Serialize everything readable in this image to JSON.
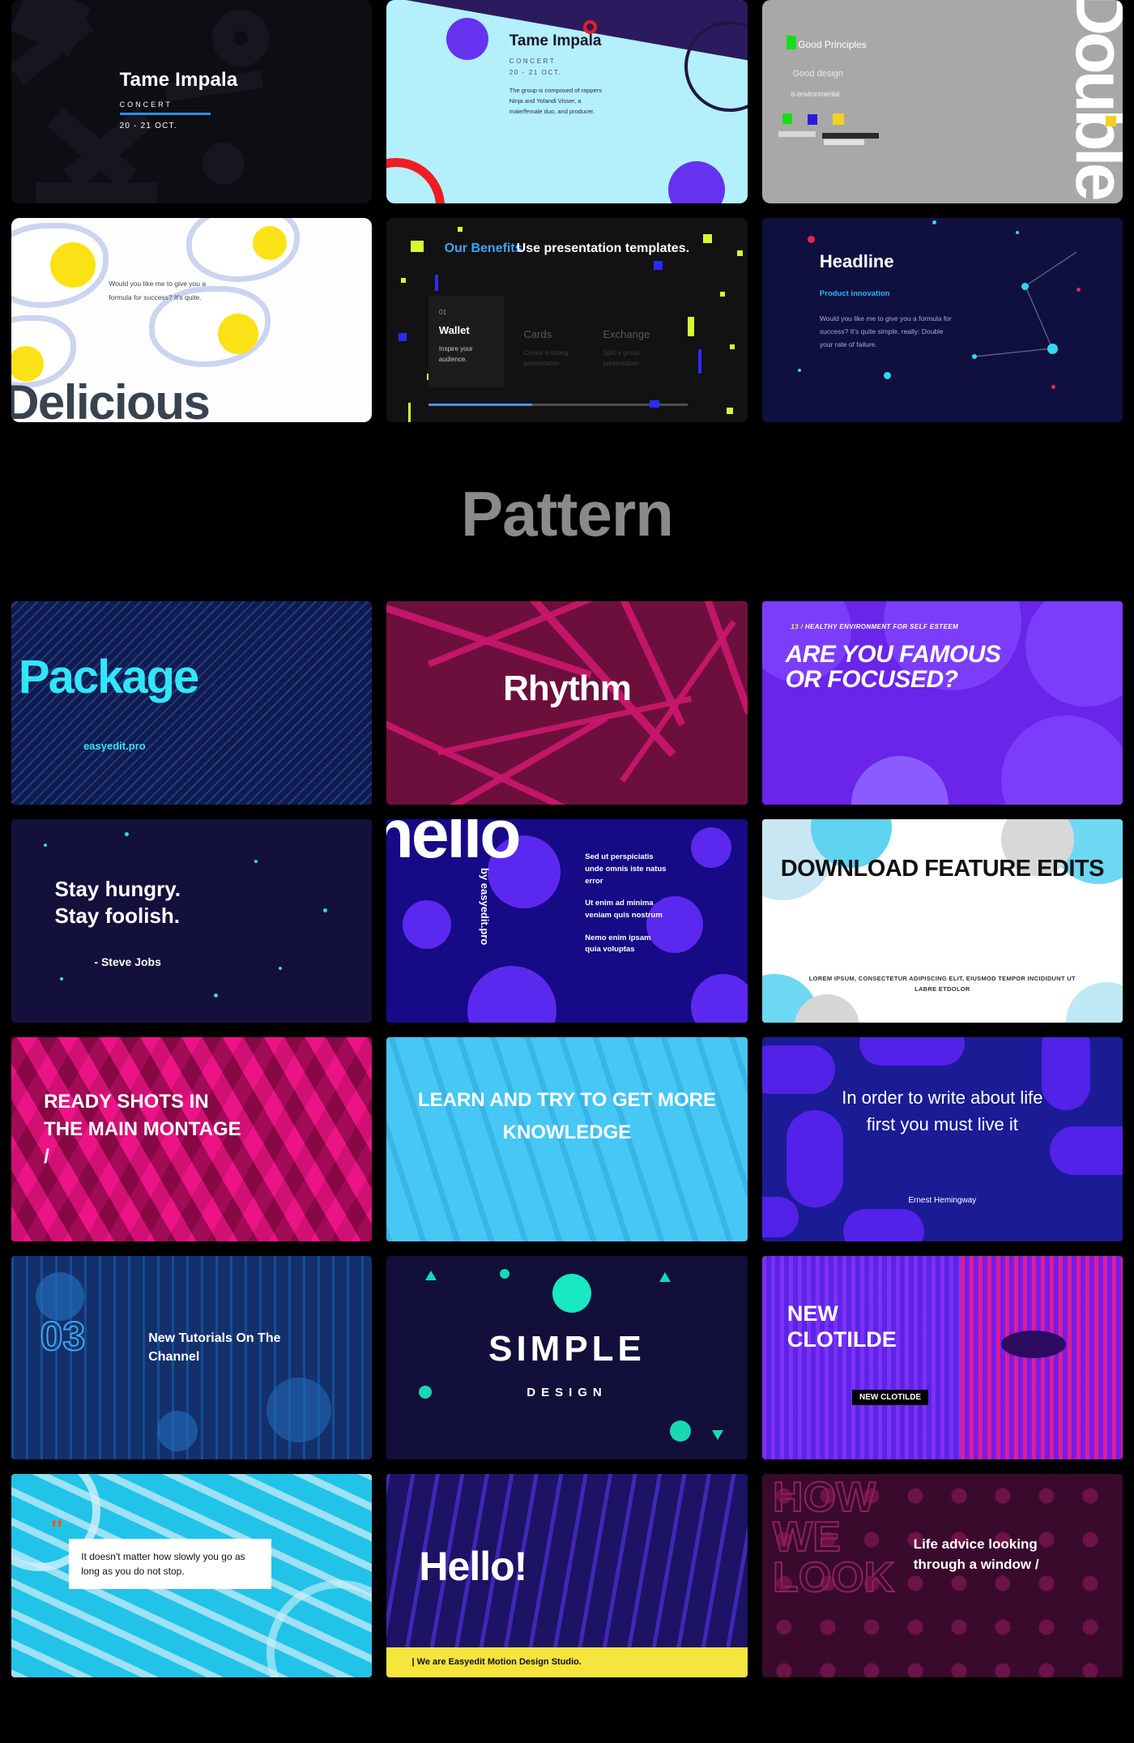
{
  "section": {
    "pattern_title": "Pattern"
  },
  "row1": {
    "card1": {
      "title": "Tame Impala",
      "subtitle": "CONCERT",
      "date": "20 - 21 OCT."
    },
    "card2": {
      "title": "Tame Impala",
      "subtitle": "CONCERT",
      "date": "20 - 21 OCT.",
      "body": "The group is composed of rappers Ninja and Yolandi Visser, a male/female duo, and producer."
    },
    "card3": {
      "heading": "Good Principles",
      "line2": "Good design",
      "line3": "is environmental",
      "big_word": "Double"
    }
  },
  "row2": {
    "card1": {
      "body": "Would you like me to give you a formula for success? It's quite.",
      "big_word": "Delicious"
    },
    "card2": {
      "eyebrow": "Our Benefits",
      "headline": "Use presentation templates.",
      "items": [
        {
          "num": "01",
          "title": "Wallet",
          "desc": "Inspire your audience."
        },
        {
          "num": "",
          "title": "Cards",
          "desc": "Create a strong presentation."
        },
        {
          "num": "",
          "title": "Exchange",
          "desc": "Split a group presentation."
        }
      ]
    },
    "card3": {
      "title": "Headline",
      "subtitle": "Product innovation",
      "body": "Would you like me to give you a formula for success? It's quite simple, really: Double your rate of failure."
    }
  },
  "pattern": {
    "package": {
      "word": "Package",
      "sub": "easyedit.pro"
    },
    "rhythm": {
      "word": "Rhythm"
    },
    "famous": {
      "number": "13 /",
      "kicker": "HEALTHY ENVIRONMENT FOR SELF ESTEEM",
      "headline": "ARE YOU FAMOUS OR FOCUSED?"
    },
    "hungry": {
      "line1": "Stay hungry.",
      "line2": "Stay foolish.",
      "author": "- Steve Jobs"
    },
    "hello": {
      "word": "hello",
      "vertical": "by easyedit.pro",
      "paragraphs": [
        "Sed ut perspiciatis unde omnis iste natus error",
        "Ut enim ad minima veniam quis nostrum",
        "Nemo enim ipsam quia voluptas"
      ]
    },
    "download": {
      "headline": "DOWNLOAD FEATURE EDITS",
      "sub": "LOREM IPSUM, CONSECTETUR ADIPISCING ELIT, EIUSMOD TEMPOR INCIDIDUNT UT LABRE ETDOLOR"
    },
    "ready": {
      "headline": "READY SHOTS IN THE MAIN MONTAGE /"
    },
    "learn": {
      "headline": "LEARN AND TRY TO GET MORE KNOWLEDGE"
    },
    "write": {
      "headline": "In order to write about life first you must live it",
      "author": "Ernest Hemingway"
    },
    "tutorials": {
      "number": "03",
      "title": "New Tutorials On The Channel"
    },
    "simple": {
      "word": "SIMPLE",
      "sub": "DESIGN"
    },
    "clotilde": {
      "title": "NEW CLOTILDE",
      "badge": "NEW CLOTILDE"
    },
    "slow": {
      "quote": "It doesn't matter how slowly you go as long as you do not stop."
    },
    "hi": {
      "word": "Hello!",
      "bar": "| We are Easyedit Motion Design Studio."
    },
    "how": {
      "big": "HOW WE LOOK",
      "text": "Life advice looking through a window /"
    }
  },
  "colors": {
    "accent_blue": "#2f8fe0",
    "accent_cyan": "#31e6f7",
    "accent_yellow": "#e6ff1a",
    "accent_purple": "#6533f0",
    "accent_pink": "#e91e8c",
    "accent_red": "#ee1d24"
  }
}
